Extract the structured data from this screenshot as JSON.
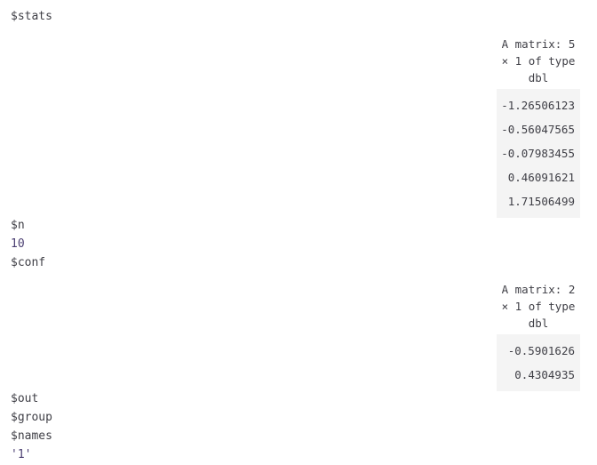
{
  "notebook_output": {
    "lines_top": [
      {
        "text": "$stats",
        "kind": "key"
      }
    ],
    "lines_middle": [
      {
        "text": "$n",
        "kind": "key"
      },
      {
        "text": "10",
        "kind": "num"
      },
      {
        "text": "$conf",
        "kind": "key"
      }
    ],
    "lines_bottom": [
      {
        "text": "$out",
        "kind": "key"
      },
      {
        "text": "$group",
        "kind": "key"
      },
      {
        "text": "$names",
        "kind": "key"
      },
      {
        "text": "'1'",
        "kind": "str"
      }
    ]
  },
  "matrix_stats": {
    "caption": "A matrix: 5 × 1 of type dbl",
    "rows": 5,
    "cols": 1,
    "dtype": "dbl",
    "values": [
      "-1.26506123",
      "-0.56047565",
      "-0.07983455",
      "0.46091621",
      "1.71506499"
    ]
  },
  "matrix_conf": {
    "caption": "A matrix: 2 × 1 of type dbl",
    "rows": 2,
    "cols": 1,
    "dtype": "dbl",
    "values": [
      "-0.5901626",
      "0.4304935"
    ]
  },
  "colors": {
    "text": "#3f3f46",
    "number": "#4b3f72",
    "string": "#4b3f72",
    "cell_background": "#f4f4f4",
    "page_background": "#ffffff"
  }
}
